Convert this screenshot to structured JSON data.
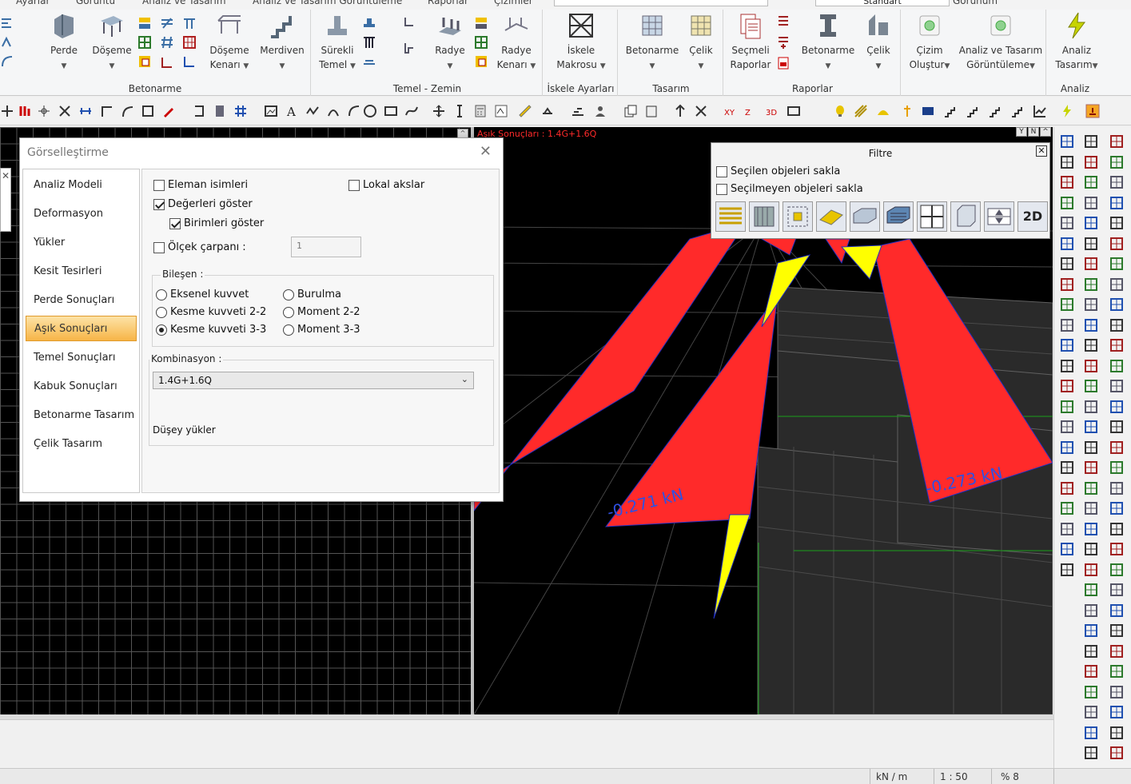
{
  "menubar": {
    "items": [
      "Ayarlar",
      "Görüntü",
      "Analiz ve Tasarım",
      "Analiz ve Tasarım Görüntüleme",
      "Raporlar",
      "Çizimler"
    ],
    "style_value": "Standart",
    "right_item": "Görünüm"
  },
  "ribbon": {
    "groups": [
      {
        "label": "Betonarme",
        "buttons": [
          {
            "label": "Perde"
          },
          {
            "label": "Döşeme"
          },
          {
            "label": "Döşeme",
            "label2": "Kenarı"
          },
          {
            "label": "Merdiven"
          }
        ]
      },
      {
        "label": "Temel - Zemin",
        "buttons": [
          {
            "label": "Sürekli",
            "label2": "Temel"
          },
          {
            "label": "Radye"
          },
          {
            "label": "Radye",
            "label2": "Kenarı"
          }
        ]
      },
      {
        "label": "İskele Ayarları",
        "buttons": [
          {
            "label": "İskele",
            "label2": "Makrosu"
          }
        ]
      },
      {
        "label": "Tasarım",
        "buttons": [
          {
            "label": "Betonarme"
          },
          {
            "label": "Çelik"
          }
        ]
      },
      {
        "label": "Raporlar",
        "buttons": [
          {
            "label": "Seçmeli",
            "label2": "Raporlar"
          },
          {
            "label": "Betonarme"
          },
          {
            "label": "Çelik"
          }
        ]
      },
      {
        "label": "",
        "buttons": [
          {
            "label": "Çizim",
            "label2": "Oluştur"
          },
          {
            "label": "Analiz ve Tasarım",
            "label2": "Görüntüleme"
          }
        ]
      },
      {
        "label": "Analiz",
        "buttons": [
          {
            "label": "Analiz",
            "label2": "Tasarım"
          }
        ]
      }
    ]
  },
  "viewport": {
    "title": "Aşık Sonuçları : 1.4G+1.6Q",
    "controls": [
      "Y",
      "N",
      "^"
    ],
    "labels": [
      "-0.271 kN",
      "-0.273 kN"
    ],
    "colors": {
      "fill": "#ff2a2a",
      "accent": "#ffff00",
      "grid": "#4a4a4a",
      "support": "#19a019"
    }
  },
  "dialog": {
    "title": "Görselleştirme",
    "nav": [
      "Analiz Modeli",
      "Deformasyon",
      "Yükler",
      "Kesit Tesirleri",
      "Perde Sonuçları",
      "Aşık Sonuçları",
      "Temel Sonuçları",
      "Kabuk Sonuçları",
      "Betonarme Tasarım",
      "Çelik Tasarım"
    ],
    "active_nav": "Aşık Sonuçları",
    "checks": {
      "eleman_isimleri": {
        "label": "Eleman isimleri",
        "checked": false
      },
      "degerleri_goster": {
        "label": "Değerleri göster",
        "checked": true
      },
      "birimleri_goster": {
        "label": "Birimleri göster",
        "checked": true
      },
      "lokal_akslar": {
        "label": "Lokal akslar",
        "checked": false
      },
      "olcek_carpani": {
        "label": "Ölçek çarpanı :",
        "checked": false,
        "value": "1"
      }
    },
    "bilesen": {
      "label": "Bileşen :",
      "options": [
        "Eksenel kuvvet",
        "Kesme kuvveti 2-2",
        "Kesme kuvveti 3-3",
        "Burulma",
        "Moment 2-2",
        "Moment 3-3"
      ],
      "selected": "Kesme kuvveti 3-3"
    },
    "kombinasyon": {
      "label": "Kombinasyon :",
      "value": "1.4G+1.6Q",
      "description": "Düşey yükler"
    }
  },
  "filtre": {
    "title": "Filtre",
    "options": [
      {
        "label": "Seçilen objeleri sakla",
        "checked": false
      },
      {
        "label": "Seçilmeyen objeleri sakla",
        "checked": false
      }
    ],
    "tools": [
      "beam-filter-icon",
      "wall-filter-icon",
      "column-filter-icon",
      "slab-filter-icon",
      "foundation-filter-icon",
      "mesh-filter-icon",
      "grid-filter-icon",
      "box-filter-icon",
      "elevation-filter-icon",
      "2d-view-icon"
    ],
    "last_tool_label": "2D"
  },
  "statusbar": {
    "unit": "kN / m",
    "scale": "1 : 50",
    "zoom": "% 8"
  }
}
